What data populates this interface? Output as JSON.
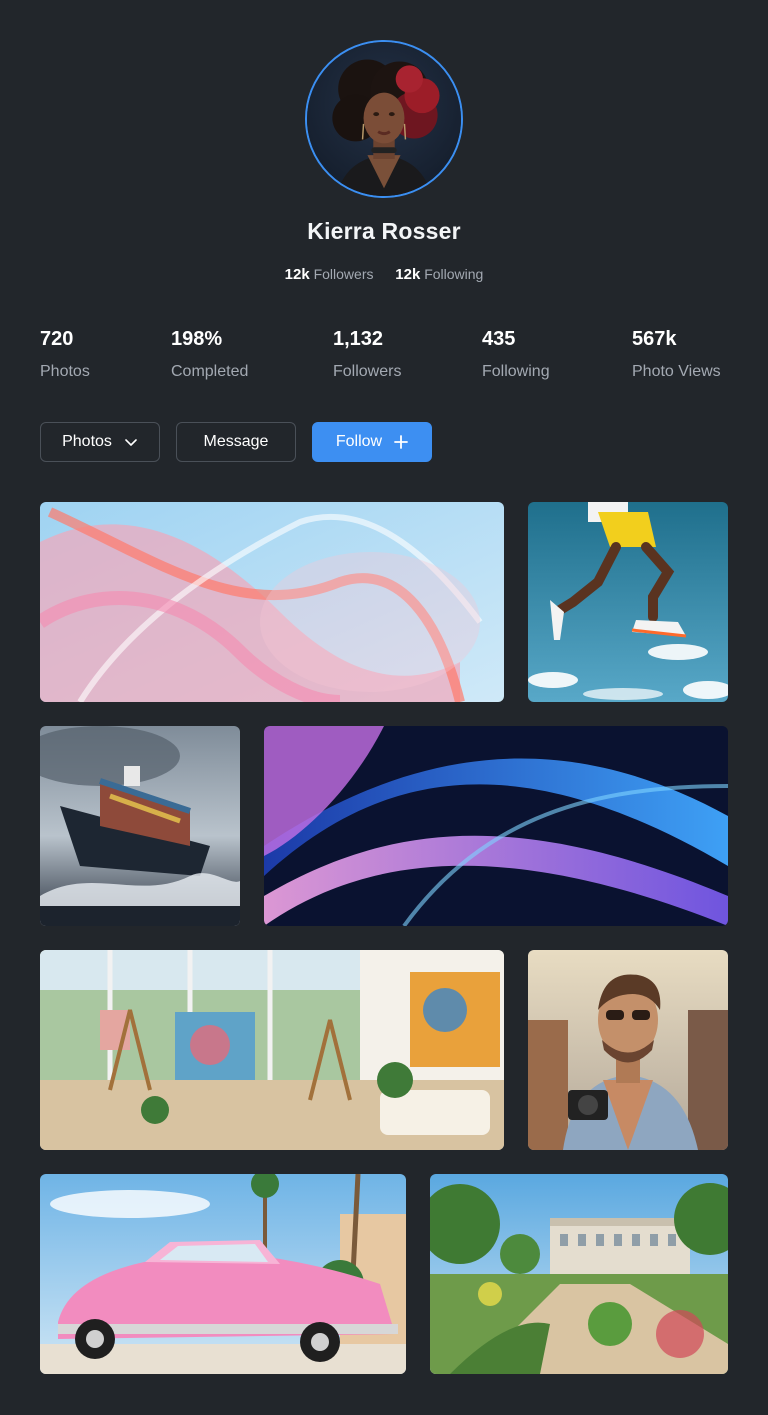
{
  "profile": {
    "name": "Kierra Rosser",
    "followers_count": "12k",
    "followers_label": "Followers",
    "following_count": "12k",
    "following_label": "Following"
  },
  "stats": [
    {
      "value": "720",
      "label": "Photos"
    },
    {
      "value": "198%",
      "label": "Completed"
    },
    {
      "value": "1,132",
      "label": "Followers"
    },
    {
      "value": "435",
      "label": "Following"
    },
    {
      "value": "567k",
      "label": "Photo Views"
    }
  ],
  "actions": {
    "filter_label": "Photos",
    "message_label": "Message",
    "follow_label": "Follow"
  },
  "colors": {
    "background": "#22262b",
    "accent": "#3d8ff2",
    "muted_text": "#a3a9b2"
  },
  "icons": {
    "filter": "chevron-down-icon",
    "follow": "plus-icon"
  }
}
